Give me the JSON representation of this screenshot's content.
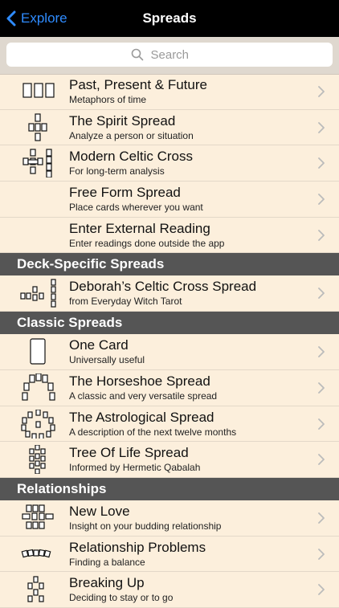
{
  "nav": {
    "back_label": "Explore",
    "title": "Spreads"
  },
  "search": {
    "placeholder": "Search"
  },
  "groups": [
    {
      "header": "",
      "items": [
        {
          "title": "Past, Present & Future",
          "subtitle": "Metaphors of time",
          "icon": "three-card-icon"
        },
        {
          "title": "The Spirit Spread",
          "subtitle": "Analyze a person or situation",
          "icon": "spirit-spread-icon"
        },
        {
          "title": "Modern Celtic Cross",
          "subtitle": "For long-term analysis",
          "icon": "celtic-cross-icon"
        },
        {
          "title": "Free Form Spread",
          "subtitle": "Place cards wherever you want",
          "icon": ""
        },
        {
          "title": "Enter External Reading",
          "subtitle": "Enter readings done outside the app",
          "icon": ""
        }
      ]
    },
    {
      "header": "Deck-Specific Spreads",
      "items": [
        {
          "title": "Deborah’s Celtic Cross Spread",
          "subtitle": "from Everyday Witch Tarot",
          "icon": "deborah-cross-icon"
        }
      ]
    },
    {
      "header": "Classic Spreads",
      "items": [
        {
          "title": "One Card",
          "subtitle": "Universally useful",
          "icon": "one-card-icon"
        },
        {
          "title": "The Horseshoe Spread",
          "subtitle": "A classic and very versatile spread",
          "icon": "horseshoe-icon"
        },
        {
          "title": "The Astrological Spread",
          "subtitle": "A description of the next twelve months",
          "icon": "astrological-icon"
        },
        {
          "title": "Tree Of Life Spread",
          "subtitle": "Informed by Hermetic Qabalah",
          "icon": "tree-of-life-icon"
        }
      ]
    },
    {
      "header": "Relationships",
      "items": [
        {
          "title": "New Love",
          "subtitle": "Insight on your budding relationship",
          "icon": "new-love-icon"
        },
        {
          "title": "Relationship Problems",
          "subtitle": "Finding a balance",
          "icon": "relationship-problems-icon"
        },
        {
          "title": "Breaking Up",
          "subtitle": "Deciding to stay or to go",
          "icon": "breaking-up-icon"
        }
      ]
    }
  ]
}
